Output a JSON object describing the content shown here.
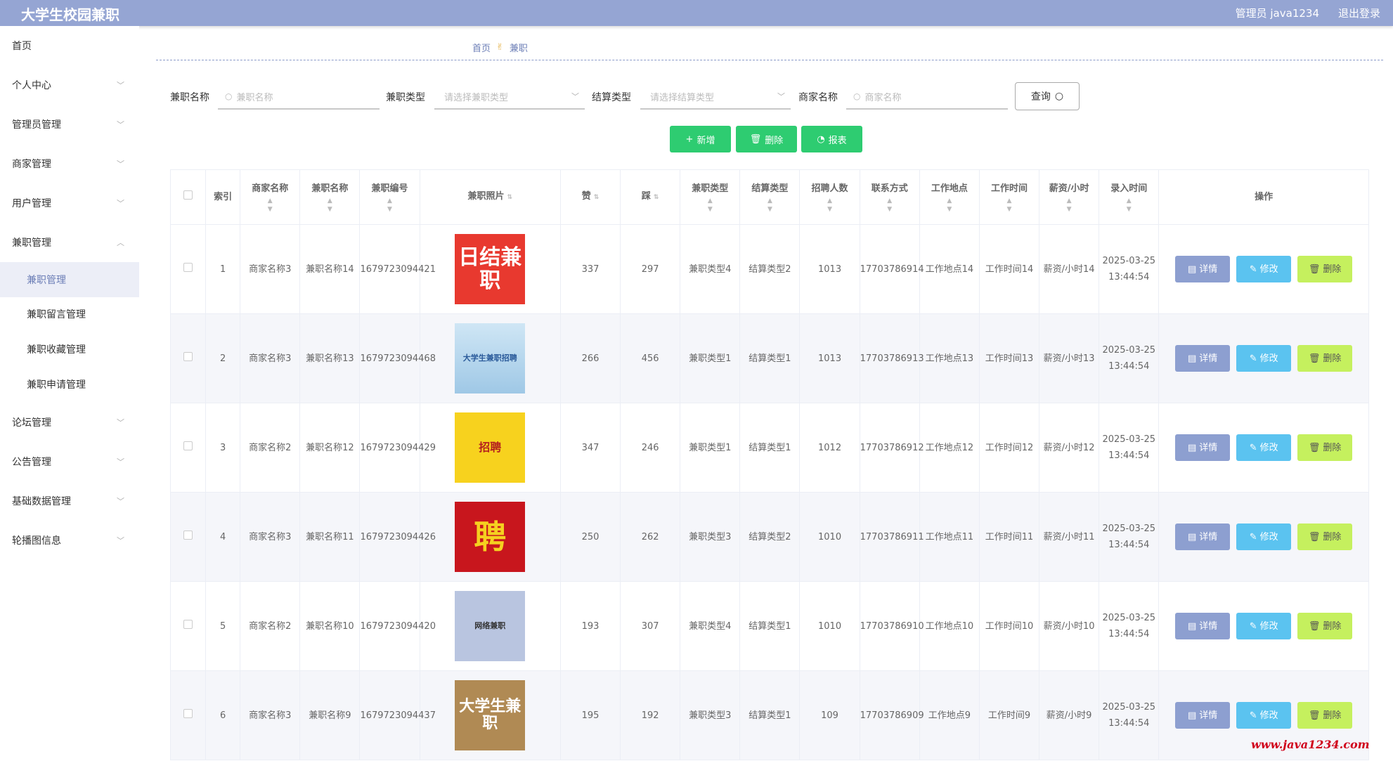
{
  "header": {
    "title": "大学生校园兼职",
    "admin": "管理员 java1234",
    "logout": "退出登录"
  },
  "sidebar": {
    "items": [
      {
        "label": "首页",
        "chevron": false
      },
      {
        "label": "个人中心",
        "chevron": true
      },
      {
        "label": "管理员管理",
        "chevron": true
      },
      {
        "label": "商家管理",
        "chevron": true
      },
      {
        "label": "用户管理",
        "chevron": true
      },
      {
        "label": "兼职管理",
        "chevron": true,
        "expanded": true
      },
      {
        "label": "兼职管理",
        "sub": true,
        "active": true
      },
      {
        "label": "兼职留言管理",
        "sub": true
      },
      {
        "label": "兼职收藏管理",
        "sub": true
      },
      {
        "label": "兼职申请管理",
        "sub": true
      },
      {
        "label": "论坛管理",
        "chevron": true
      },
      {
        "label": "公告管理",
        "chevron": true
      },
      {
        "label": "基础数据管理",
        "chevron": true
      },
      {
        "label": "轮播图信息",
        "chevron": true
      }
    ]
  },
  "breadcrumb": {
    "home": "首页",
    "current": "兼职"
  },
  "filters": {
    "name_label": "兼职名称",
    "name_placeholder": "兼职名称",
    "type_label": "兼职类型",
    "type_placeholder": "请选择兼职类型",
    "settle_label": "结算类型",
    "settle_placeholder": "请选择结算类型",
    "merchant_label": "商家名称",
    "merchant_placeholder": "商家名称",
    "query": "查询"
  },
  "actions": {
    "add": "新增",
    "delete": "删除",
    "report": "报表"
  },
  "table": {
    "headers": [
      "索引",
      "商家名称",
      "兼职名称",
      "兼职编号",
      "兼职照片",
      "赞",
      "踩",
      "兼职类型",
      "结算类型",
      "招聘人数",
      "联系方式",
      "工作地点",
      "工作时间",
      "薪资/小时",
      "录入时间",
      "操作"
    ],
    "rows": [
      {
        "idx": "1",
        "merchant": "商家名称3",
        "name": "兼职名称14",
        "code": "1679723094421",
        "photo": "日结兼职",
        "like": "337",
        "dislike": "297",
        "jtype": "兼职类型4",
        "stype": "结算类型2",
        "count": "1013",
        "phone": "17703786914",
        "place": "工作地点14",
        "time": "工作时间14",
        "salary": "薪资/小时14",
        "created": "2025-03-25 13:44:54"
      },
      {
        "idx": "2",
        "merchant": "商家名称3",
        "name": "兼职名称13",
        "code": "1679723094468",
        "photo": "大学生兼职招聘",
        "like": "266",
        "dislike": "456",
        "jtype": "兼职类型1",
        "stype": "结算类型1",
        "count": "1013",
        "phone": "17703786913",
        "place": "工作地点13",
        "time": "工作时间13",
        "salary": "薪资/小时13",
        "created": "2025-03-25 13:44:54"
      },
      {
        "idx": "3",
        "merchant": "商家名称2",
        "name": "兼职名称12",
        "code": "1679723094429",
        "photo": "招聘",
        "like": "347",
        "dislike": "246",
        "jtype": "兼职类型1",
        "stype": "结算类型1",
        "count": "1012",
        "phone": "17703786912",
        "place": "工作地点12",
        "time": "工作时间12",
        "salary": "薪资/小时12",
        "created": "2025-03-25 13:44:54"
      },
      {
        "idx": "4",
        "merchant": "商家名称3",
        "name": "兼职名称11",
        "code": "1679723094426",
        "photo": "聘",
        "like": "250",
        "dislike": "262",
        "jtype": "兼职类型3",
        "stype": "结算类型2",
        "count": "1010",
        "phone": "17703786911",
        "place": "工作地点11",
        "time": "工作时间11",
        "salary": "薪资/小时11",
        "created": "2025-03-25 13:44:54"
      },
      {
        "idx": "5",
        "merchant": "商家名称2",
        "name": "兼职名称10",
        "code": "1679723094420",
        "photo": "网络兼职",
        "like": "193",
        "dislike": "307",
        "jtype": "兼职类型4",
        "stype": "结算类型1",
        "count": "1010",
        "phone": "17703786910",
        "place": "工作地点10",
        "time": "工作时间10",
        "salary": "薪资/小时10",
        "created": "2025-03-25 13:44:54"
      },
      {
        "idx": "6",
        "merchant": "商家名称3",
        "name": "兼职名称9",
        "code": "1679723094437",
        "photo": "大学生兼职",
        "like": "195",
        "dislike": "192",
        "jtype": "兼职类型3",
        "stype": "结算类型1",
        "count": "109",
        "phone": "17703786909",
        "place": "工作地点9",
        "time": "工作时间9",
        "salary": "薪资/小时9",
        "created": "2025-03-25 13:44:54"
      }
    ],
    "row_actions": {
      "detail": "详情",
      "edit": "修改",
      "delete": "删除"
    }
  },
  "colors": {
    "header": "#95a5d3",
    "add": "#2ecc71",
    "detail": "#8d9fd0",
    "edit": "#5bc3f0",
    "delete": "#c5f05e"
  },
  "watermark": "www.java1234.com"
}
